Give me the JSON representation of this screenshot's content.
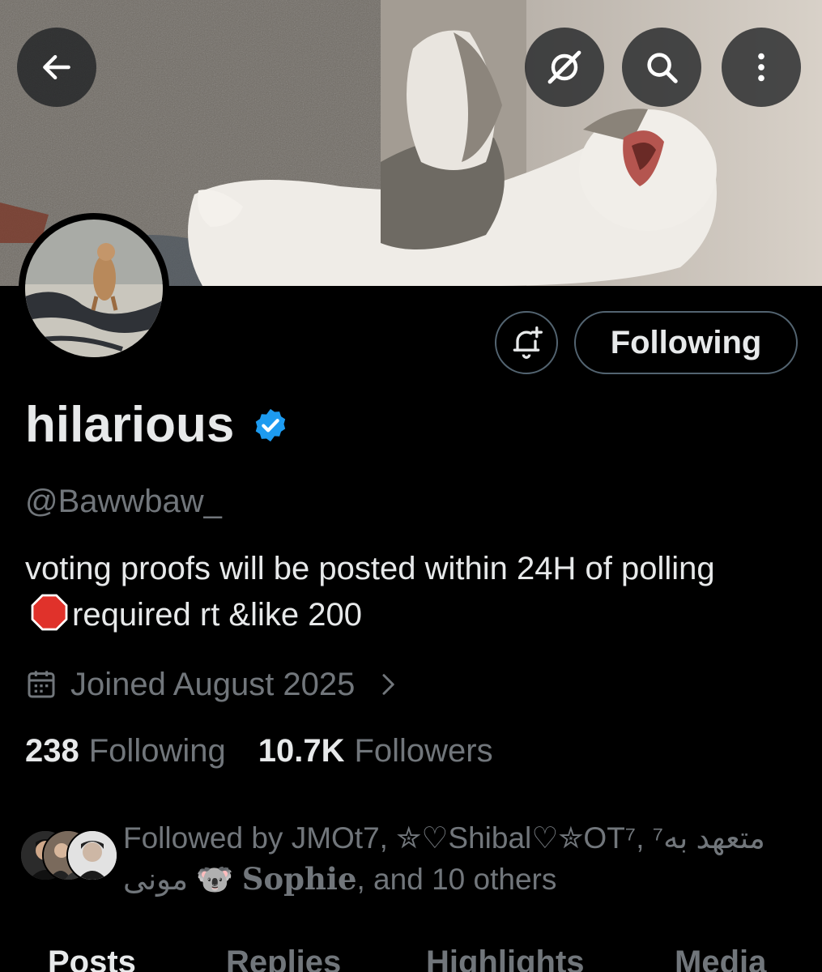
{
  "header": {
    "back_icon": "arrow-left-icon",
    "grok_icon": "grok-icon",
    "search_icon": "search-icon",
    "more_icon": "more-vertical-icon"
  },
  "profile": {
    "display_name": "hilarious",
    "verified": true,
    "handle": "@Bawwbaw_",
    "bio_part1": "voting proofs will be posted within 24H of polling",
    "bio_emoji": "stop-sign-emoji",
    "bio_part2": "required rt &like 200",
    "joined": "Joined August 2025"
  },
  "actions": {
    "notify_icon": "bell-plus-icon",
    "following_label": "Following"
  },
  "stats": {
    "following_count": "238",
    "following_label": "Following",
    "followers_count": "10.7K",
    "followers_label": "Followers"
  },
  "followed_by": {
    "prefix": "Followed by JMOt7, ✮♡Shibal♡✮OT⁷, ⁷متعهد به مونى ",
    "koala": "🐨",
    "sophie": "Sophie",
    "suffix": ", and 10 others"
  },
  "tabs": [
    {
      "label": "Posts",
      "active": true
    },
    {
      "label": "Replies",
      "active": false
    },
    {
      "label": "Highlights",
      "active": false
    },
    {
      "label": "Media",
      "active": false
    }
  ],
  "colors": {
    "background": "#000000",
    "text_primary": "#e7e9ea",
    "text_secondary": "#71767b",
    "verified_blue": "#1d9bf0",
    "border": "#536471"
  }
}
